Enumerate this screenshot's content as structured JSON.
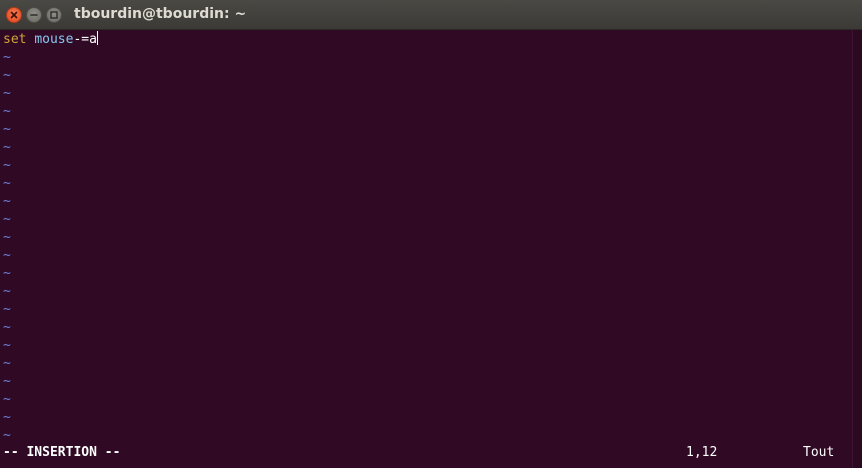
{
  "window": {
    "title": "tbourdin@tbourdin: ~"
  },
  "editor": {
    "lines": [
      {
        "keyword": "set",
        "option": "mouse",
        "operator": "-=",
        "value": "a"
      }
    ],
    "empty_line_marker": "~",
    "empty_line_count": 22
  },
  "statusline": {
    "mode": "-- INSERTION --",
    "cursor_position": "1,12",
    "scroll_position": "Tout"
  },
  "colors": {
    "background": "#300a24",
    "keyword": "#d1a33b",
    "identifier": "#8ac6f2",
    "tilde": "#6d7ed8",
    "text": "#ffffff",
    "close_button": "#e2441c"
  }
}
